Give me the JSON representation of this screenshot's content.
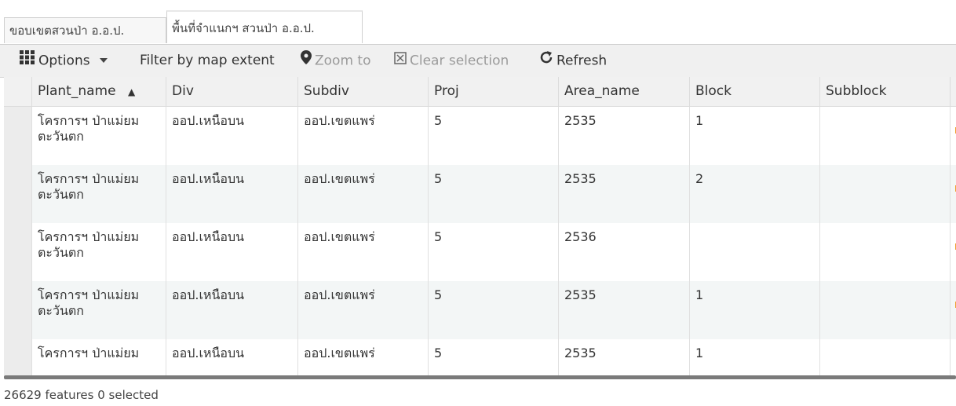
{
  "tabs": [
    {
      "label": "ขอบเขตสวนป่า อ.อ.ป."
    },
    {
      "label": "พื้นที่จำแนกฯ สวนป่า อ.อ.ป."
    }
  ],
  "toolbar": {
    "options_label": "Options",
    "filter_label": "Filter by map extent",
    "zoom_label": "Zoom to",
    "clear_label": "Clear selection",
    "refresh_label": "Refresh"
  },
  "table": {
    "columns": [
      "Plant_name",
      "Div",
      "Subdiv",
      "Proj",
      "Area_name",
      "Block",
      "Subblock"
    ],
    "sort_indicator": "▲",
    "rows": [
      [
        "โครการฯ ป่าแม่ยม ตะวันตก",
        "ออป.เหนือบน",
        "ออป.เขตแพร่",
        "5",
        "2535",
        "1",
        ""
      ],
      [
        "โครการฯ ป่าแม่ยม ตะวันตก",
        "ออป.เหนือบน",
        "ออป.เขตแพร่",
        "5",
        "2535",
        "2",
        ""
      ],
      [
        "โครการฯ ป่าแม่ยม ตะวันตก",
        "ออป.เหนือบน",
        "ออป.เขตแพร่",
        "5",
        "2536",
        "",
        ""
      ],
      [
        "โครการฯ ป่าแม่ยม ตะวันตก",
        "ออป.เหนือบน",
        "ออป.เขตแพร่",
        "5",
        "2535",
        "1",
        ""
      ],
      [
        "โครการฯ ป่าแม่ยม",
        "ออป.เหนือบน",
        "ออป.เขตแพร่",
        "5",
        "2535",
        "1",
        ""
      ]
    ]
  },
  "status": {
    "text": "26629 features 0 selected"
  },
  "colors": {
    "accent_orange": "#f0a030",
    "header_bg": "#f1f1f1",
    "stripe": "#f3f6f6"
  }
}
